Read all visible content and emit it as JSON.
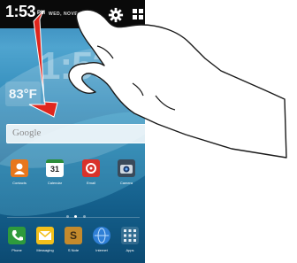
{
  "status_bar": {
    "time": "1:53",
    "ampm": "PM",
    "date": "WED, NOVE..."
  },
  "home": {
    "clock": "1:53",
    "weather_temp": "83°F",
    "search_label": "Google"
  },
  "apps": [
    {
      "label": "Contacts",
      "icon": "contacts-icon",
      "color": "#e8771c"
    },
    {
      "label": "Calendar",
      "icon": "calendar-icon",
      "color": "#ffffff",
      "value": "31"
    },
    {
      "label": "Email",
      "icon": "email-icon",
      "color": "#d9322b"
    },
    {
      "label": "Camera",
      "icon": "camera-icon",
      "color": "#3a4a5a"
    }
  ],
  "dock": [
    {
      "label": "Phone",
      "icon": "phone-icon",
      "color": "#2e9a3c"
    },
    {
      "label": "Messaging",
      "icon": "messaging-icon",
      "color": "#f3c01b"
    },
    {
      "label": "S Note",
      "icon": "s-note-icon",
      "color": "#c48a2c"
    },
    {
      "label": "Internet",
      "icon": "internet-icon",
      "color": "#2f7fd6"
    },
    {
      "label": "Apps",
      "icon": "apps-icon",
      "color": "#5a6e80"
    }
  ],
  "pager": {
    "pages": 3,
    "active": 2
  },
  "colors": {
    "arrow": "#e0261d",
    "hand_fill": "#ffffff",
    "hand_stroke": "#1a1a1a"
  }
}
